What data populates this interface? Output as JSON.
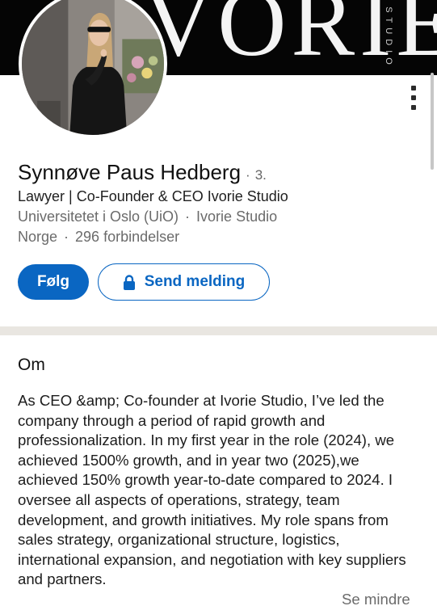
{
  "banner": {
    "wordmark": "VORIE",
    "side_text": "STUDIO"
  },
  "profile": {
    "name": "Synnøve Paus Hedberg",
    "degree_separator": "·",
    "degree": "3.",
    "headline": "Lawyer | Co-Founder & CEO Ivorie Studio",
    "education": "Universitetet i Oslo (UiO)",
    "meta_separator": "·",
    "company": "Ivorie Studio",
    "location": "Norge",
    "connections": "296 forbindelser"
  },
  "actions": {
    "follow_label": "Følg",
    "message_label": "Send melding",
    "message_icon": "lock-icon"
  },
  "menu": {
    "more_icon": "vertical-dots-icon"
  },
  "about": {
    "title": "Om",
    "text": "As CEO &amp; Co-founder at Ivorie Studio, I’ve led the company through a period of rapid growth and professionalization. In my first year in the role (2024), we achieved 1500% growth, and in year two (2025),we achieved 150% growth year-to-date compared to 2024. I oversee all aspects of operations, strategy, team development, and growth initiatives. My role spans from sales strategy, organizational structure, logistics, international expansion, and negotiation with key suppliers and partners.",
    "toggle_label": "Se mindre"
  },
  "colors": {
    "accent": "#0a66c2",
    "banner": "#050505",
    "section_gap": "#e9e6e1",
    "muted_text": "#6b6b6b"
  }
}
